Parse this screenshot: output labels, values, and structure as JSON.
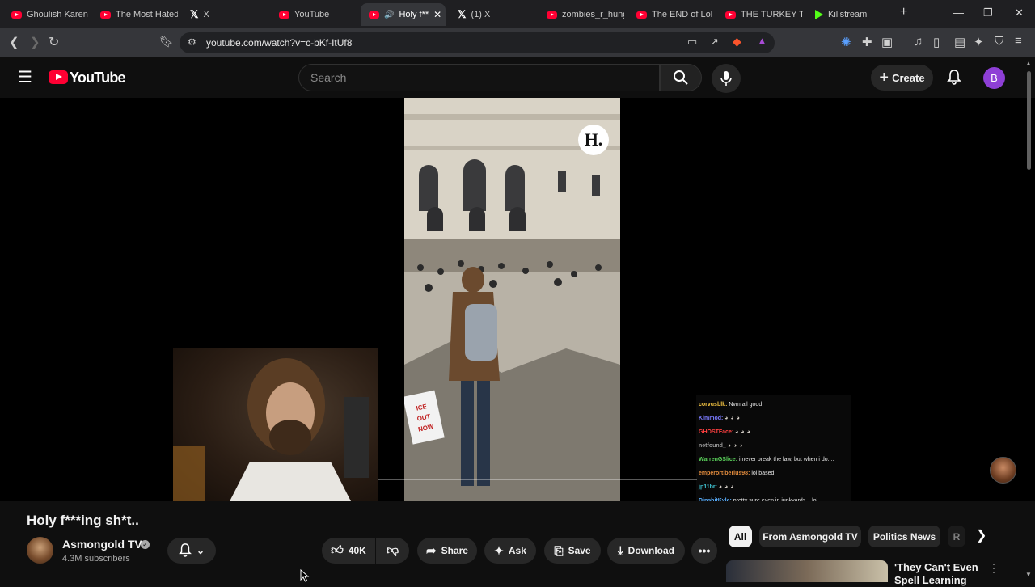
{
  "browser": {
    "tabs": [
      {
        "title": "Ghoulish Karen",
        "favicon": "youtube-icon"
      },
      {
        "title": "The Most Hated",
        "favicon": "youtube-icon"
      },
      {
        "title": "X",
        "favicon": "x-icon"
      },
      {
        "title": "YouTube",
        "favicon": "youtube-icon"
      },
      {
        "title": "Holy f**",
        "favicon": "youtube-icon",
        "active": true
      },
      {
        "title": "(1) X",
        "favicon": "x-icon"
      },
      {
        "title": "zombies_r_hung",
        "favicon": "youtube-icon"
      },
      {
        "title": "The END of Lol",
        "favicon": "youtube-icon"
      },
      {
        "title": "THE TURKEY TO",
        "favicon": "youtube-icon"
      },
      {
        "title": "Killstream",
        "favicon": "kick-icon"
      }
    ],
    "url": "youtube.com/watch?v=c-bKf-ItUf8"
  },
  "youtube": {
    "logo": "YouTube",
    "search_placeholder": "Search",
    "create_label": "Create",
    "avatar_letter": "B"
  },
  "video": {
    "overlay_logo": "H.",
    "sign_text": "ICE OUT NOW",
    "chat": [
      {
        "user": "corvusblk:",
        "text": "Nvm all good",
        "color": "#f5c542"
      },
      {
        "user": "Kimmod:",
        "text": "",
        "color": "#7b7bff"
      },
      {
        "user": "GHOSTFace:",
        "text": "",
        "color": "#ff4040"
      },
      {
        "user": "netfound_",
        "text": "",
        "color": "#9a9a9a"
      },
      {
        "user": "WarrenGSlice:",
        "text": "i never break the law, but when i do....",
        "color": "#5cd65c"
      },
      {
        "user": "emperortiberius98:",
        "text": "lol based",
        "color": "#e08a3c"
      },
      {
        "user": "jp11br:",
        "text": "",
        "color": "#41c7d6"
      },
      {
        "user": "DipshitKyle:",
        "text": "pretty sure even in junkyards... lol",
        "color": "#5ab0ff"
      }
    ]
  },
  "details": {
    "title": "Holy f***ing sh*t..",
    "channel": "Asmongold TV",
    "subscribers": "4.3M subscribers",
    "likes": "40K",
    "share_label": "Share",
    "ask_label": "Ask",
    "save_label": "Save",
    "download_label": "Download"
  },
  "sidebar": {
    "chips": [
      "All",
      "From Asmongold TV",
      "Politics News",
      "R"
    ],
    "rec_title": "'They Can't Even Spell Learning"
  },
  "colors": {
    "youtube_red": "#ff0033",
    "avatar_purple": "#8e3fd6",
    "background": "#0f0f0f"
  }
}
